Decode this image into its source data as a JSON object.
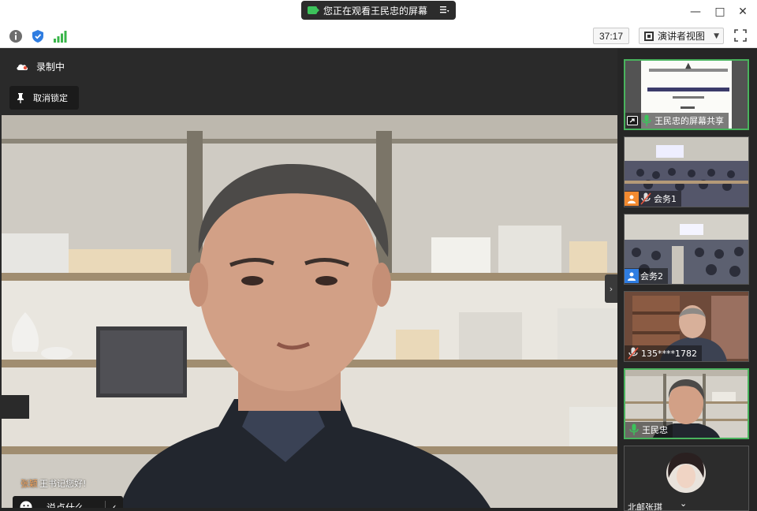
{
  "titlebar": {
    "sharing_text": "您正在观看王民忠的屏幕",
    "minimize": "—",
    "maximize": "□",
    "close": "✕"
  },
  "toolbar": {
    "timer": "37:17",
    "view_mode": "演讲者视图",
    "icons": [
      "info-icon",
      "shield-icon",
      "signal-icon",
      "fullscreen-icon"
    ]
  },
  "stage": {
    "recording_label": "录制中",
    "unpin_label": "取消锁定",
    "chat": {
      "sender": "张颖",
      "message": "王书记您好!",
      "input_placeholder": "说点什么..."
    }
  },
  "participants": [
    {
      "name": "王民忠的屏幕共享",
      "type": "screen-share"
    },
    {
      "name": "会务1",
      "type": "avatar-orange"
    },
    {
      "name": "会务2",
      "type": "avatar-blue"
    },
    {
      "name": "135****1782",
      "type": "video"
    },
    {
      "name": "王民忠",
      "type": "video",
      "active": true
    },
    {
      "name": "北邮张琪",
      "type": "avatar-photo"
    }
  ],
  "colors": {
    "accent_green": "#49b35d",
    "mic_green": "#3cc35b",
    "avatar_orange": "#f28a30",
    "avatar_blue": "#2f7de1",
    "sender_orange": "#f3a35a"
  }
}
